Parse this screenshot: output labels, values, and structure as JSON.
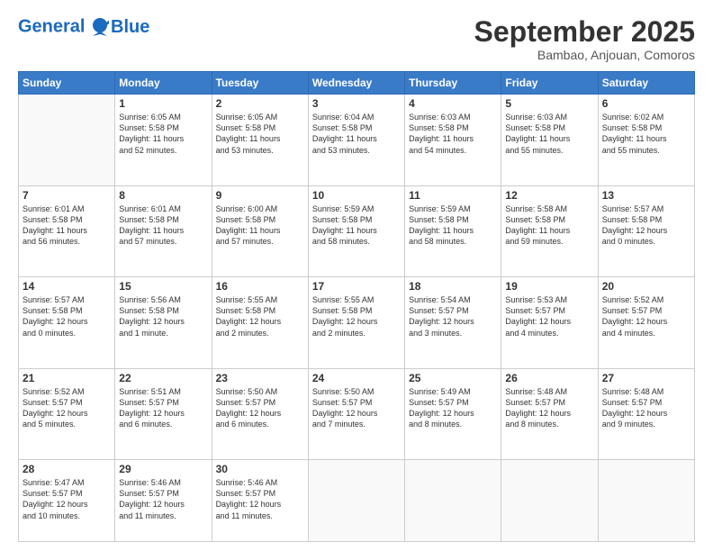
{
  "header": {
    "logo_line1": "General",
    "logo_line2": "Blue",
    "month": "September 2025",
    "location": "Bambao, Anjouan, Comoros"
  },
  "days_of_week": [
    "Sunday",
    "Monday",
    "Tuesday",
    "Wednesday",
    "Thursday",
    "Friday",
    "Saturday"
  ],
  "weeks": [
    [
      {
        "day": "",
        "text": ""
      },
      {
        "day": "1",
        "text": "Sunrise: 6:05 AM\nSunset: 5:58 PM\nDaylight: 11 hours\nand 52 minutes."
      },
      {
        "day": "2",
        "text": "Sunrise: 6:05 AM\nSunset: 5:58 PM\nDaylight: 11 hours\nand 53 minutes."
      },
      {
        "day": "3",
        "text": "Sunrise: 6:04 AM\nSunset: 5:58 PM\nDaylight: 11 hours\nand 53 minutes."
      },
      {
        "day": "4",
        "text": "Sunrise: 6:03 AM\nSunset: 5:58 PM\nDaylight: 11 hours\nand 54 minutes."
      },
      {
        "day": "5",
        "text": "Sunrise: 6:03 AM\nSunset: 5:58 PM\nDaylight: 11 hours\nand 55 minutes."
      },
      {
        "day": "6",
        "text": "Sunrise: 6:02 AM\nSunset: 5:58 PM\nDaylight: 11 hours\nand 55 minutes."
      }
    ],
    [
      {
        "day": "7",
        "text": "Sunrise: 6:01 AM\nSunset: 5:58 PM\nDaylight: 11 hours\nand 56 minutes."
      },
      {
        "day": "8",
        "text": "Sunrise: 6:01 AM\nSunset: 5:58 PM\nDaylight: 11 hours\nand 57 minutes."
      },
      {
        "day": "9",
        "text": "Sunrise: 6:00 AM\nSunset: 5:58 PM\nDaylight: 11 hours\nand 57 minutes."
      },
      {
        "day": "10",
        "text": "Sunrise: 5:59 AM\nSunset: 5:58 PM\nDaylight: 11 hours\nand 58 minutes."
      },
      {
        "day": "11",
        "text": "Sunrise: 5:59 AM\nSunset: 5:58 PM\nDaylight: 11 hours\nand 58 minutes."
      },
      {
        "day": "12",
        "text": "Sunrise: 5:58 AM\nSunset: 5:58 PM\nDaylight: 11 hours\nand 59 minutes."
      },
      {
        "day": "13",
        "text": "Sunrise: 5:57 AM\nSunset: 5:58 PM\nDaylight: 12 hours\nand 0 minutes."
      }
    ],
    [
      {
        "day": "14",
        "text": "Sunrise: 5:57 AM\nSunset: 5:58 PM\nDaylight: 12 hours\nand 0 minutes."
      },
      {
        "day": "15",
        "text": "Sunrise: 5:56 AM\nSunset: 5:58 PM\nDaylight: 12 hours\nand 1 minute."
      },
      {
        "day": "16",
        "text": "Sunrise: 5:55 AM\nSunset: 5:58 PM\nDaylight: 12 hours\nand 2 minutes."
      },
      {
        "day": "17",
        "text": "Sunrise: 5:55 AM\nSunset: 5:58 PM\nDaylight: 12 hours\nand 2 minutes."
      },
      {
        "day": "18",
        "text": "Sunrise: 5:54 AM\nSunset: 5:57 PM\nDaylight: 12 hours\nand 3 minutes."
      },
      {
        "day": "19",
        "text": "Sunrise: 5:53 AM\nSunset: 5:57 PM\nDaylight: 12 hours\nand 4 minutes."
      },
      {
        "day": "20",
        "text": "Sunrise: 5:52 AM\nSunset: 5:57 PM\nDaylight: 12 hours\nand 4 minutes."
      }
    ],
    [
      {
        "day": "21",
        "text": "Sunrise: 5:52 AM\nSunset: 5:57 PM\nDaylight: 12 hours\nand 5 minutes."
      },
      {
        "day": "22",
        "text": "Sunrise: 5:51 AM\nSunset: 5:57 PM\nDaylight: 12 hours\nand 6 minutes."
      },
      {
        "day": "23",
        "text": "Sunrise: 5:50 AM\nSunset: 5:57 PM\nDaylight: 12 hours\nand 6 minutes."
      },
      {
        "day": "24",
        "text": "Sunrise: 5:50 AM\nSunset: 5:57 PM\nDaylight: 12 hours\nand 7 minutes."
      },
      {
        "day": "25",
        "text": "Sunrise: 5:49 AM\nSunset: 5:57 PM\nDaylight: 12 hours\nand 8 minutes."
      },
      {
        "day": "26",
        "text": "Sunrise: 5:48 AM\nSunset: 5:57 PM\nDaylight: 12 hours\nand 8 minutes."
      },
      {
        "day": "27",
        "text": "Sunrise: 5:48 AM\nSunset: 5:57 PM\nDaylight: 12 hours\nand 9 minutes."
      }
    ],
    [
      {
        "day": "28",
        "text": "Sunrise: 5:47 AM\nSunset: 5:57 PM\nDaylight: 12 hours\nand 10 minutes."
      },
      {
        "day": "29",
        "text": "Sunrise: 5:46 AM\nSunset: 5:57 PM\nDaylight: 12 hours\nand 11 minutes."
      },
      {
        "day": "30",
        "text": "Sunrise: 5:46 AM\nSunset: 5:57 PM\nDaylight: 12 hours\nand 11 minutes."
      },
      {
        "day": "",
        "text": ""
      },
      {
        "day": "",
        "text": ""
      },
      {
        "day": "",
        "text": ""
      },
      {
        "day": "",
        "text": ""
      }
    ]
  ]
}
